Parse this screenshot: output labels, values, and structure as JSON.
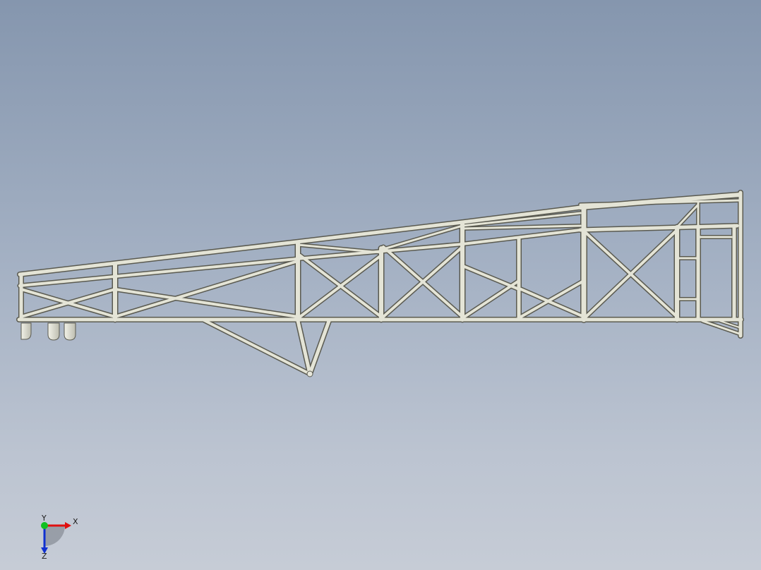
{
  "viewport": {
    "background_top": "#8596ae",
    "background_bottom": "#c6ccd6",
    "tube_color": "#e4e4d6",
    "tube_edge_color": "#5a5a50"
  },
  "model": {
    "type": "truss-frame",
    "icon": "truss-model-icon"
  },
  "triad": {
    "x_label": "X",
    "y_label": "Y",
    "z_label": "Z",
    "x_color": "#e01010",
    "y_color": "#10c020",
    "z_color": "#1030d0"
  }
}
